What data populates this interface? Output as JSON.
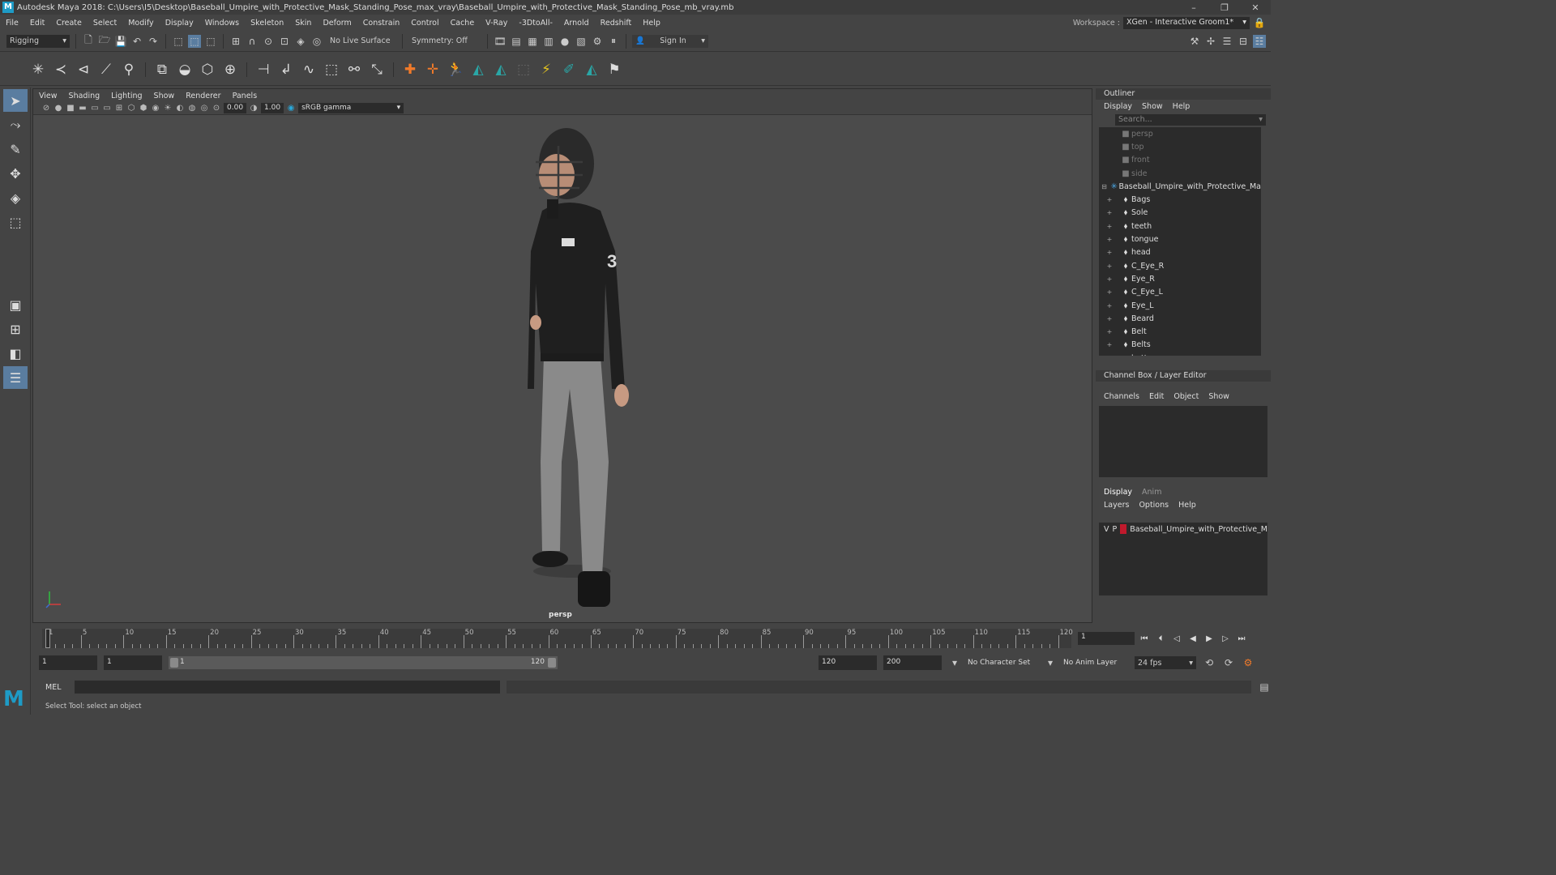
{
  "window": {
    "title": "Autodesk Maya 2018: C:\\Users\\I5\\Desktop\\Baseball_Umpire_with_Protective_Mask_Standing_Pose_max_vray\\Baseball_Umpire_with_Protective_Mask_Standing_Pose_mb_vray.mb",
    "logo_letter": "M",
    "minimize": "–",
    "restore": "❐",
    "close": "✕"
  },
  "menubar": {
    "items": [
      "File",
      "Edit",
      "Create",
      "Select",
      "Modify",
      "Display",
      "Windows",
      "Skeleton",
      "Skin",
      "Deform",
      "Constrain",
      "Control",
      "Cache",
      "V-Ray",
      "-3DtoAll-",
      "Arnold",
      "Redshift",
      "Help"
    ],
    "workspace_label": "Workspace :",
    "workspace_value": "XGen - Interactive Groom1*"
  },
  "statusline": {
    "mode": "Rigging",
    "live_surface": "No Live Surface",
    "symmetry": "Symmetry: Off",
    "sign_in": "Sign In"
  },
  "viewport": {
    "menus": [
      "View",
      "Shading",
      "Lighting",
      "Show",
      "Renderer",
      "Panels"
    ],
    "exposure": "0.00",
    "gamma": "1.00",
    "color_space": "sRGB gamma",
    "camera_label": "persp"
  },
  "outliner": {
    "title": "Outliner",
    "menus": [
      "Display",
      "Show",
      "Help"
    ],
    "search_placeholder": "Search...",
    "cameras": [
      "persp",
      "top",
      "front",
      "side"
    ],
    "root": "Baseball_Umpire_with_Protective_Ma",
    "children": [
      "Bags",
      "Sole",
      "teeth",
      "tongue",
      "head",
      "C_Eye_R",
      "Eye_R",
      "C_Eye_L",
      "Eye_L",
      "Beard",
      "Belt",
      "Belts",
      "buttons"
    ]
  },
  "channelbox": {
    "title": "Channel Box / Layer Editor",
    "menus": [
      "Channels",
      "Edit",
      "Object",
      "Show"
    ]
  },
  "layers": {
    "tabs": [
      "Display",
      "Anim"
    ],
    "menus": [
      "Layers",
      "Options",
      "Help"
    ],
    "row": {
      "v": "V",
      "p": "P",
      "name": "Baseball_Umpire_with_Protective_M",
      "color": "#c0192c"
    }
  },
  "timeline": {
    "labels": [
      "1",
      "5",
      "10",
      "15",
      "20",
      "25",
      "30",
      "35",
      "40",
      "45",
      "50",
      "55",
      "60",
      "65",
      "70",
      "75",
      "80",
      "85",
      "90",
      "95",
      "100",
      "105",
      "110",
      "115",
      "120"
    ],
    "current_frame": "1"
  },
  "range": {
    "start": "1",
    "playback_start": "1",
    "slider_start": "1",
    "slider_end": "120",
    "playback_end": "120",
    "end": "200",
    "character_set": "No Character Set",
    "anim_layer": "No Anim Layer",
    "fps": "24 fps"
  },
  "command": {
    "mel_label": "MEL"
  },
  "help_line": "Select Tool: select an object"
}
